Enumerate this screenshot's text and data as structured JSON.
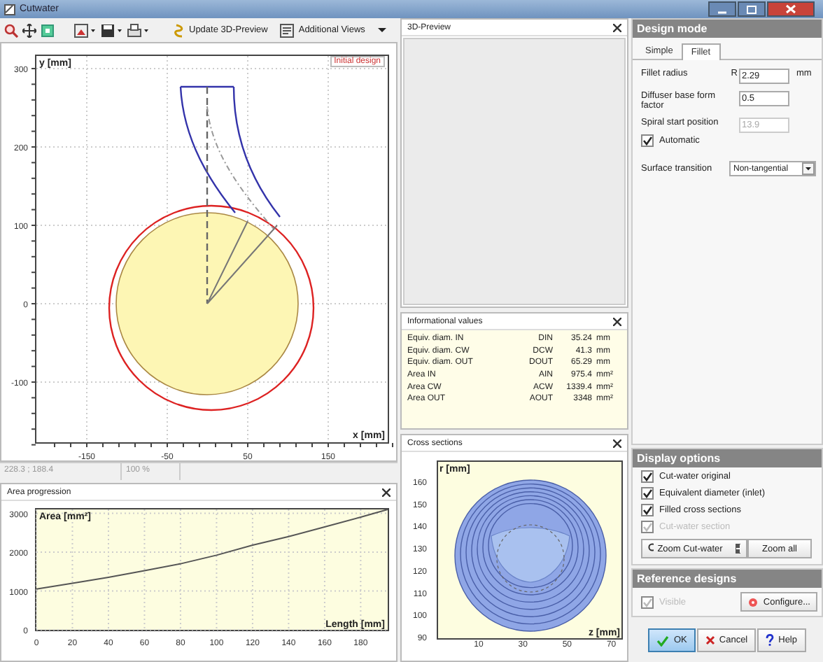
{
  "window": {
    "title": "Cutwater"
  },
  "toolbar": {
    "update_button": "Update 3D-Preview",
    "views_button": "Additional Views"
  },
  "contour_plot": {
    "y_label": "y [mm]",
    "x_label": "x [mm]",
    "legend": "Initial design",
    "x_ticks": [
      "-150",
      "-50",
      "50",
      "150"
    ],
    "y_ticks": [
      "300",
      "200",
      "100",
      "0",
      "-100"
    ]
  },
  "status_bar": [
    "228.3 ; 188.4",
    "100 %"
  ],
  "area_progression": {
    "title": "Area progression",
    "chart_data": {
      "type": "line",
      "xlabel": "Length [mm]",
      "ylabel": "Area [mm²]",
      "x": [
        0,
        20,
        40,
        60,
        80,
        100,
        120,
        140,
        160,
        180,
        195
      ],
      "series": [
        {
          "color": "#555555",
          "values": [
            1050,
            1200,
            1350,
            1520,
            1700,
            1920,
            2180,
            2400,
            2650,
            2900,
            3100
          ]
        }
      ],
      "xlim": [
        0,
        195
      ],
      "ylim": [
        0,
        3100
      ],
      "grid": true,
      "xticks": [
        0,
        20,
        40,
        60,
        80,
        100,
        120,
        140,
        160,
        180
      ],
      "yticks": [
        0,
        1000,
        2000,
        3000
      ]
    }
  },
  "preview_3d": {
    "title": "3D-Preview"
  },
  "informational_values": {
    "title": "Informational values",
    "rows": [
      {
        "label": "Equiv. diam. IN",
        "symbol": "DIN",
        "value": "35.24",
        "unit": "mm"
      },
      {
        "label": "Equiv. diam. CW",
        "symbol": "DCW",
        "value": "41.3",
        "unit": "mm"
      },
      {
        "label": "Equiv. diam. OUT",
        "symbol": "DOUT",
        "value": "65.29",
        "unit": "mm"
      },
      {
        "label": "Area IN",
        "symbol": "AIN",
        "value": "975.4",
        "unit": "mm²"
      },
      {
        "label": "Area CW",
        "symbol": "ACW",
        "value": "1339.4",
        "unit": "mm²"
      },
      {
        "label": "Area OUT",
        "symbol": "AOUT",
        "value": "3348",
        "unit": "mm²"
      }
    ]
  },
  "cross_sections": {
    "title": "Cross sections",
    "y_label": "r [mm]",
    "x_label": "z [mm]",
    "x_ticks": [
      "10",
      "30",
      "50",
      "70"
    ],
    "y_ticks": [
      "160",
      "150",
      "140",
      "130",
      "120",
      "110",
      "100",
      "90"
    ]
  },
  "design_mode": {
    "title": "Design mode",
    "tabs": [
      {
        "label": "Simple",
        "selected": false
      },
      {
        "label": "Fillet",
        "selected": true
      }
    ],
    "fields": [
      {
        "kind": "input",
        "label": "Fillet radius",
        "prefix": "R",
        "value": "2.29",
        "unit": "mm",
        "disabled": false
      },
      {
        "kind": "input",
        "label": "Diffuser base form factor",
        "value": "0.5",
        "disabled": false
      },
      {
        "kind": "input",
        "label": "Spiral start position",
        "value": "13.9",
        "disabled": true
      },
      {
        "kind": "checkbox",
        "label": "Automatic",
        "checked": true
      },
      {
        "kind": "select",
        "label": "Surface transition",
        "value": "Non-tangential"
      }
    ]
  },
  "display_options": {
    "title": "Display options",
    "checkboxes": [
      {
        "label": "Cut-water original",
        "checked": true,
        "disabled": false
      },
      {
        "label": "Equivalent diameter (inlet)",
        "checked": true,
        "disabled": false
      },
      {
        "label": "Filled cross sections",
        "checked": true,
        "disabled": false
      },
      {
        "label": "Cut-water section",
        "checked": true,
        "disabled": true
      }
    ],
    "buttons": [
      "Zoom Cut-water",
      "Zoom all"
    ]
  },
  "reference_designs": {
    "title": "Reference designs",
    "checkbox": {
      "label": "Visible",
      "checked": true,
      "disabled": true
    },
    "button": "Configure..."
  },
  "dialog_buttons": [
    {
      "label": "OK",
      "default": true
    },
    {
      "label": "Cancel",
      "default": false
    },
    {
      "label": "Help",
      "default": false
    }
  ]
}
